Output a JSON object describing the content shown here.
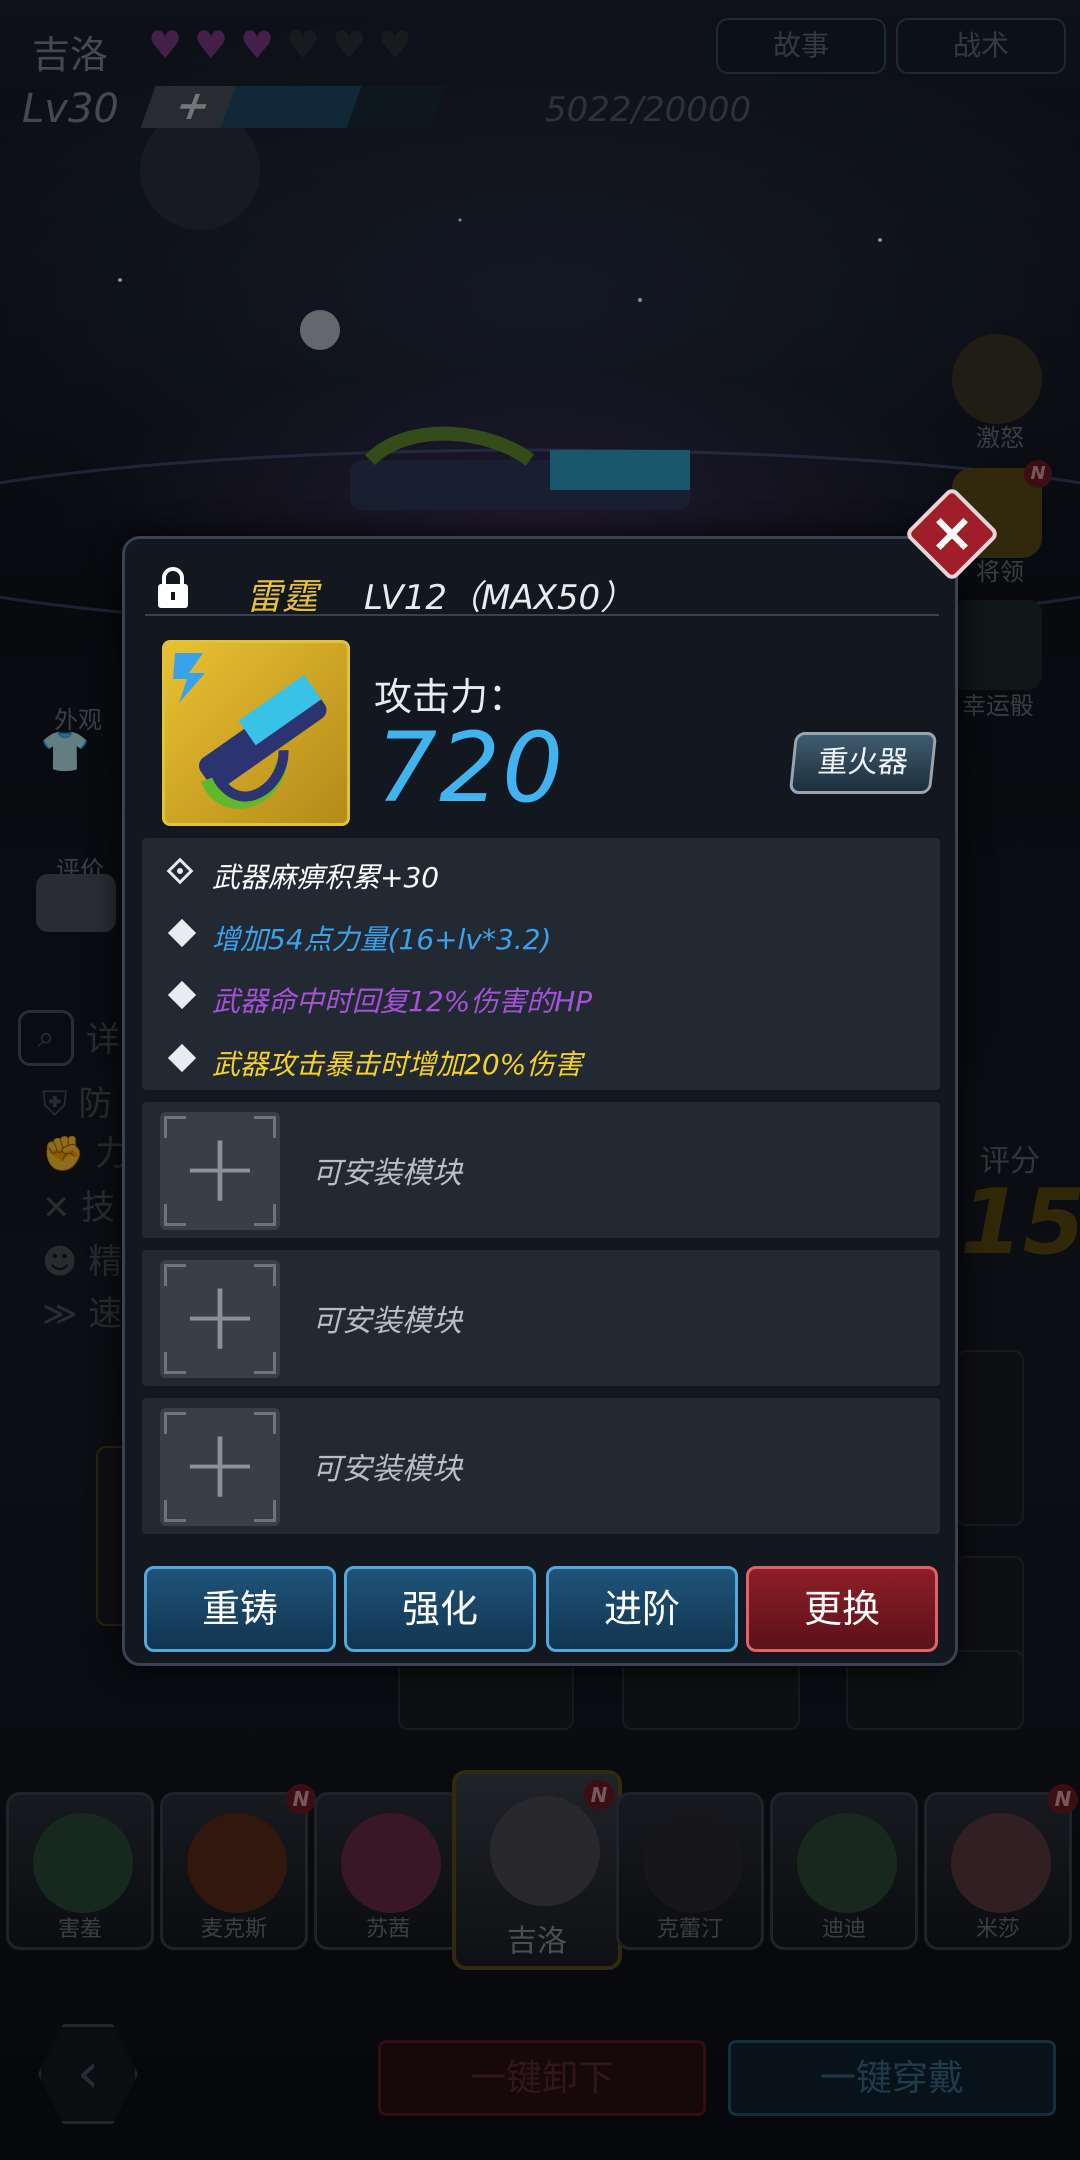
{
  "header": {
    "character_name": "吉洛",
    "hearts_filled": 3,
    "hearts_total": 6,
    "level": "Lv30",
    "xp_plus": "+",
    "xp_text": "5022/20000",
    "xp_fraction": 0.25,
    "story_button": "故事",
    "tactics_button": "战术"
  },
  "side": {
    "rage": "激怒",
    "general": "将领",
    "lucky_dice": "幸运骰",
    "badge_n": "N"
  },
  "left_menu": {
    "appearance": "外观",
    "rating": "评价",
    "details_prefix": "详",
    "stats": [
      "防",
      "力",
      "技",
      "精",
      "速"
    ]
  },
  "score": {
    "label": "评分",
    "value": "15"
  },
  "panel": {
    "weapon_name": "雷霆",
    "weapon_level": "LV12（MAX50）",
    "attack_label": "攻击力：",
    "attack_value": "720",
    "weapon_type": "重火器",
    "attributes": [
      {
        "text": "武器麻痹积累+30",
        "color": "#ffffff"
      },
      {
        "text": "增加54点力量(16+lv*3.2)",
        "color": "#3aa2ea"
      },
      {
        "text": "武器命中时回复12%伤害的HP",
        "color": "#a452d6"
      },
      {
        "text": "武器攻击暴击时增加20%伤害",
        "color": "#f2d12a"
      }
    ],
    "module_plus": "+",
    "modules": [
      "可安装模块",
      "可安装模块",
      "可安装模块"
    ],
    "close_icon": "×",
    "buttons": {
      "recast": "重铸",
      "enhance": "强化",
      "advance": "进阶",
      "replace": "更换"
    }
  },
  "characters": [
    {
      "name": "害羞",
      "new": false
    },
    {
      "name": "麦克斯",
      "new": true
    },
    {
      "name": "苏茜",
      "new": false
    },
    {
      "name": "吉洛",
      "new": true,
      "selected": true
    },
    {
      "name": "克蕾汀",
      "new": false
    },
    {
      "name": "迪迪",
      "new": false
    },
    {
      "name": "米莎",
      "new": true
    }
  ],
  "bottom": {
    "back_icon": "‹",
    "unequip_all": "一键卸下",
    "equip_all": "一键穿戴"
  },
  "colors": {
    "accent_blue": "#41b4ef",
    "name_gold": "#e6c23a",
    "replace_red": "#a01e2a"
  }
}
